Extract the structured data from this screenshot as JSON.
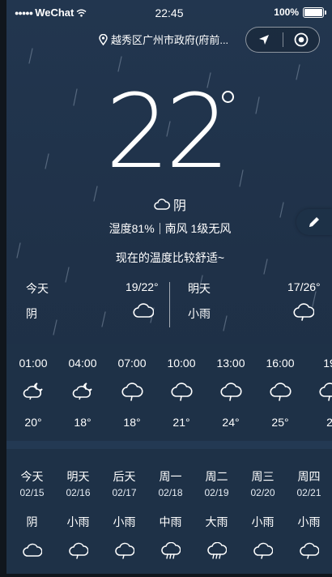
{
  "status_bar": {
    "signal": "●●●●●",
    "carrier": "WeChat",
    "time": "22:45",
    "battery": "100%"
  },
  "location": {
    "text": "越秀区广州市政府(府前..."
  },
  "current": {
    "temperature": "22",
    "condition": "阴",
    "humidity": "湿度81%",
    "wind": "南风 1级无风",
    "tip": "现在的温度比较舒适~"
  },
  "two_day": [
    {
      "name": "今天",
      "range": "19/22°",
      "condition": "阴",
      "icon": "cloud-icon"
    },
    {
      "name": "明天",
      "range": "17/26°",
      "condition": "小雨",
      "icon": "cloud-rain-icon"
    }
  ],
  "hourly": [
    {
      "time": "01:00",
      "temp": "20°",
      "icon": "cloud-moon-icon"
    },
    {
      "time": "04:00",
      "temp": "18°",
      "icon": "cloud-moon-icon"
    },
    {
      "time": "07:00",
      "temp": "18°",
      "icon": "cloud-rain-icon"
    },
    {
      "time": "10:00",
      "temp": "21°",
      "icon": "cloud-rain-icon"
    },
    {
      "time": "13:00",
      "temp": "24°",
      "icon": "cloud-rain-icon"
    },
    {
      "time": "16:00",
      "temp": "25°",
      "icon": "cloud-rain-icon"
    },
    {
      "time": "19",
      "temp": "2",
      "icon": "cloud-rain-icon"
    }
  ],
  "weekly": [
    {
      "day": "今天",
      "date": "02/15",
      "condition": "阴",
      "icon": "cloud-icon"
    },
    {
      "day": "明天",
      "date": "02/16",
      "condition": "小雨",
      "icon": "cloud-rain-icon"
    },
    {
      "day": "后天",
      "date": "02/17",
      "condition": "小雨",
      "icon": "cloud-rain-icon"
    },
    {
      "day": "周一",
      "date": "02/18",
      "condition": "中雨",
      "icon": "cloud-heavy-rain-icon"
    },
    {
      "day": "周二",
      "date": "02/19",
      "condition": "大雨",
      "icon": "cloud-heavy-rain-icon"
    },
    {
      "day": "周三",
      "date": "02/20",
      "condition": "小雨",
      "icon": "cloud-rain-icon"
    },
    {
      "day": "周四",
      "date": "02/21",
      "condition": "小雨",
      "icon": "cloud-rain-icon"
    }
  ]
}
